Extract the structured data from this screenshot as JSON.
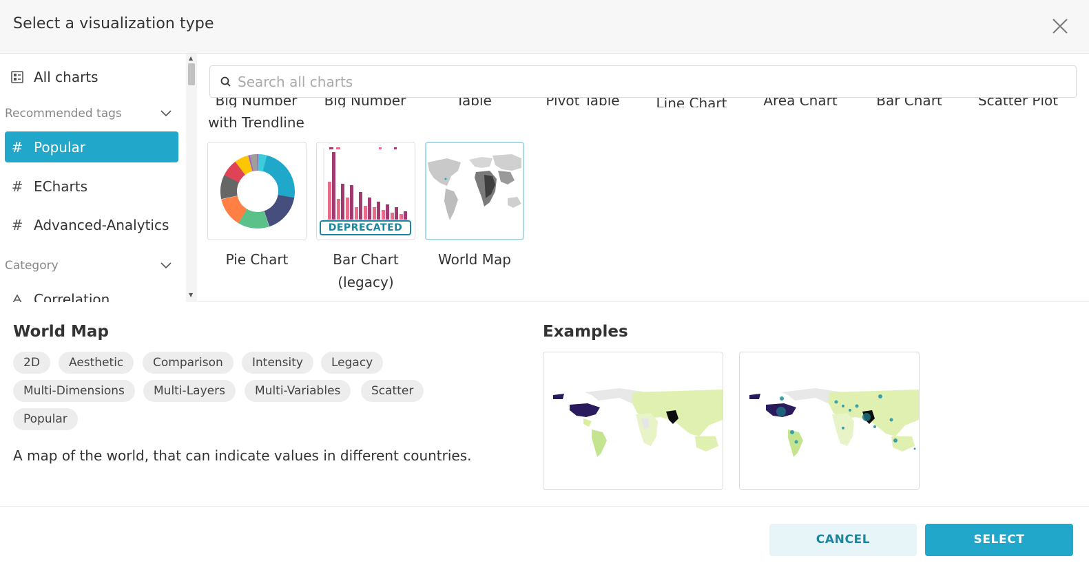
{
  "header": {
    "title": "Select a visualization type"
  },
  "sidebar": {
    "all_charts": "All charts",
    "recommended_tags": "Recommended tags",
    "tags": [
      "Popular",
      "ECharts",
      "Advanced-Analytics"
    ],
    "category": "Category",
    "categories": [
      "Correlation"
    ]
  },
  "search": {
    "placeholder": "Search all charts",
    "value": ""
  },
  "gallery": {
    "cut_row": [
      "Big Number",
      "Big Number",
      "Table",
      "Pivot Table",
      "Line Chart",
      "Area Chart",
      "Bar Chart",
      "Scatter Plot"
    ],
    "cut_row_second_line": "with Trendline",
    "tiles": [
      {
        "label": "Pie Chart"
      },
      {
        "label_line1": "Bar Chart",
        "label_line2": "(legacy)",
        "badge": "DEPRECATED"
      },
      {
        "label": "World Map"
      }
    ],
    "selected": "World Map"
  },
  "details": {
    "title": "World Map",
    "tags": [
      "2D",
      "Aesthetic",
      "Comparison",
      "Intensity",
      "Legacy",
      "Multi-Dimensions",
      "Multi-Layers",
      "Multi-Variables",
      "Scatter",
      "Popular"
    ],
    "description": "A map of the world, that can indicate values in different countries.",
    "examples_title": "Examples"
  },
  "footer": {
    "cancel": "CANCEL",
    "select": "SELECT"
  },
  "colors": {
    "accent": "#20a7c9",
    "accent_dark": "#1985a0",
    "cancel_bg": "#e7f4f8"
  }
}
